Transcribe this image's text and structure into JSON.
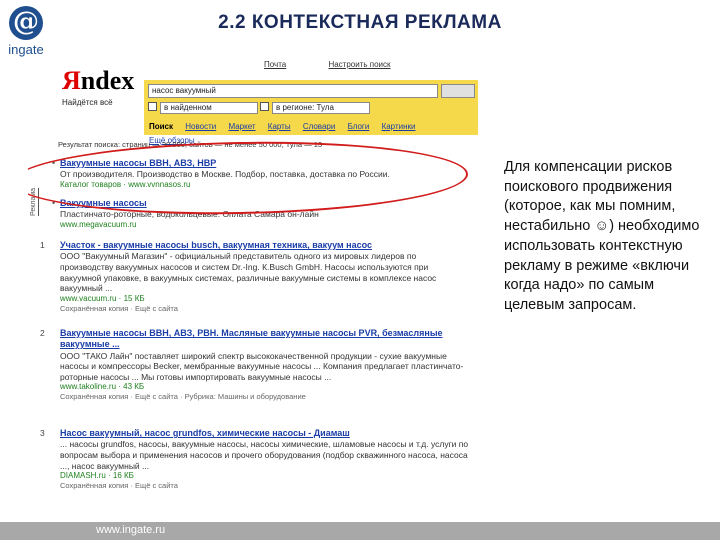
{
  "slide": {
    "title": "2.2 КОНТЕКСТНАЯ РЕКЛАМА",
    "logo_symbol": "@",
    "logo_text": "ingate",
    "footer_url": "www.ingate.ru",
    "note": "Для компенсации рисков поискового продвижения (которое, как мы помним, нестабильно ☺) необходимо использовать контекстную рекламу в режиме «включи когда надо» по самым целевым запросам."
  },
  "yandex": {
    "logo_first": "Я",
    "logo_rest": "ndex",
    "tagline": "Найдётся всё",
    "top_links": [
      "Почта",
      "Настроить поиск"
    ],
    "query": "насос вакуумный",
    "check_found": "в найденном",
    "check_region": "в регионе: Тула",
    "tabs": [
      "Поиск",
      "Новости",
      "Маркет",
      "Карты",
      "Словари",
      "Блоги",
      "Картинки",
      "Ещё обзоры"
    ],
    "stats": "Результат поиска: страниц — 30 000, сайтов — не менее 50 000; Тула — 13",
    "side_label": "Реклама",
    "ads": [
      {
        "title": "Вакуумные насосы ВВН, АВЗ, НВР",
        "desc": "От производителя. Производство в Москве. Подбор, поставка, доставка по России.",
        "url": "Каталог товаров · www.vvnnasos.ru"
      },
      {
        "title": "Вакуумные насосы",
        "desc": "Пластинчато-роторные, водокольцевые. Оплата Самара он-лайн",
        "url": "www.megavacuum.ru"
      }
    ],
    "results": [
      {
        "num": "1",
        "title": "Участок - вакуумные насосы busch, вакуумная техника, вакуум насос",
        "desc": "ООО \"Вакуумный Магазин\" - официальный представитель одного из мировых лидеров по производству вакуумных насосов и систем Dr.-Ing. К.Busch GmbH. Насосы используются при вакуумной упаковке, в вакуумных системах, различные вакуумные системы в комплексе насос вакуумный ...",
        "url": "www.vacuum.ru · 15 КБ",
        "meta": "Сохранённая копия · Ещё с сайта"
      },
      {
        "num": "2",
        "title": "Вакуумные насосы ВВН, АВЗ, РВН. Масляные вакуумные насосы РVR, безмасляные вакуумные ...",
        "desc": "ООО \"ТАКО Лайн\" поставляет широкий спектр высококачественной продукции - сухие вакуумные насосы и компрессоры Becker, мембранные вакуумные насосы ... Компания предлагает пластинчато-роторные насосы ... Мы готовы импортировать вакуумные насосы ...",
        "url": "www.takoline.ru · 43 КБ",
        "meta": "Сохранённая копия · Ещё с сайта · Рубрика: Машины и оборудование"
      },
      {
        "num": "3",
        "title": "Насос вакуумный, насос grundfos, химические насосы - Диамаш",
        "desc": "... насосы grundfos, насосы, вакуумные насосы, насосы химические, шламовые насосы и т.д. услуги по вопросам выбора и применения насосов и прочего оборудования (подбор скважинного насоса, насоса ..., насос вакуумный ...",
        "url": "DIAMASH.ru · 16 КБ",
        "meta": "Сохранённая копия · Ещё с сайта"
      }
    ]
  }
}
